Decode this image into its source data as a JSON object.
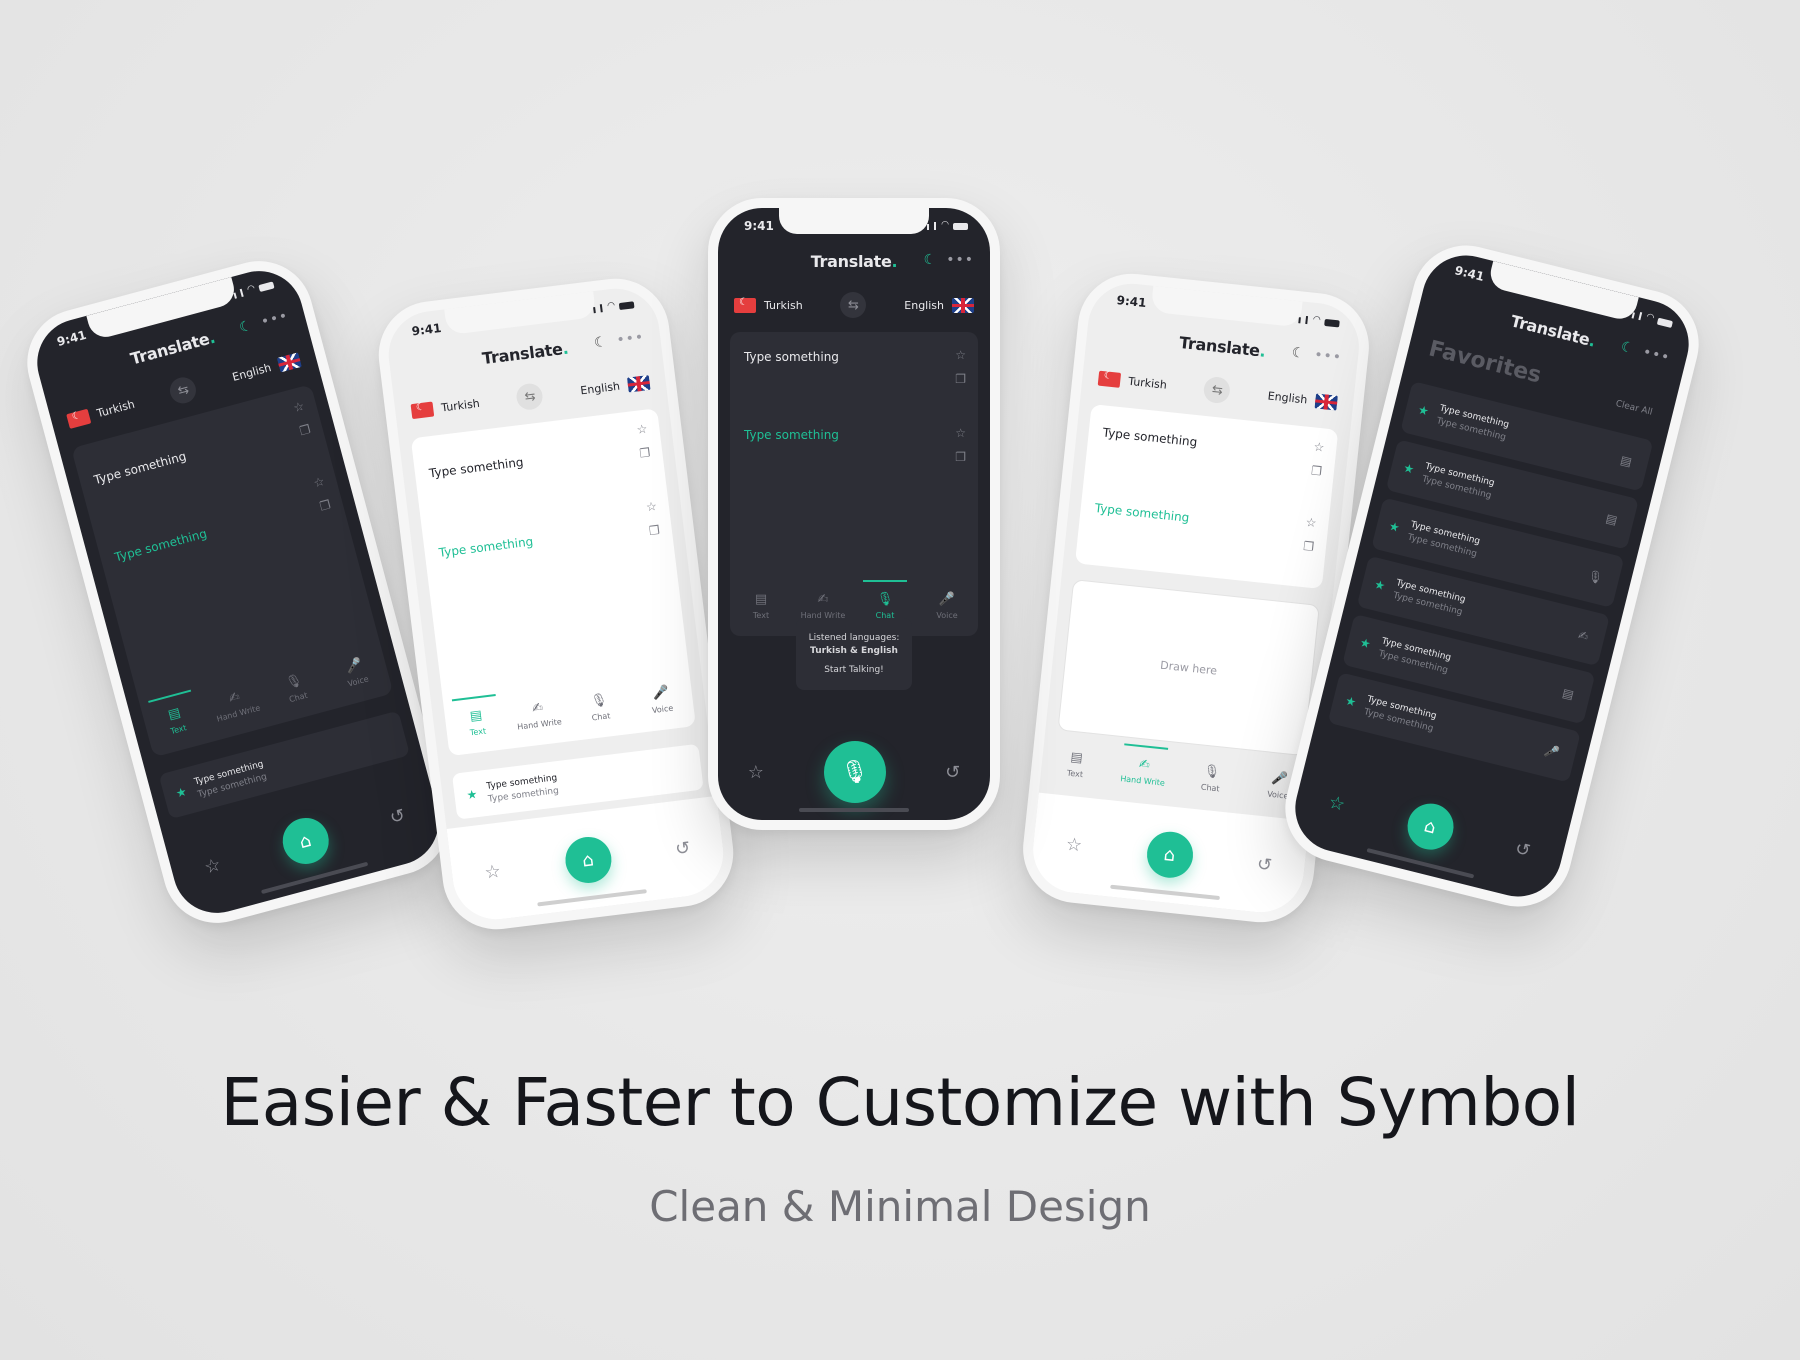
{
  "status_time": "9:41",
  "app": {
    "title": "Translate",
    "title_dot": "."
  },
  "languages": {
    "source": "Turkish",
    "target": "English"
  },
  "fields": {
    "source_text": "Type something",
    "target_text": "Type something"
  },
  "tabs": [
    {
      "label": "Text",
      "icon": "document-icon"
    },
    {
      "label": "Hand Write",
      "icon": "handwriting-icon"
    },
    {
      "label": "Chat",
      "icon": "microphones-icon"
    },
    {
      "label": "Voice",
      "icon": "microphone-icon"
    }
  ],
  "recent": {
    "title": "Type something",
    "subtitle": "Type something"
  },
  "listen": {
    "line1": "Listened languages:",
    "line2": "Turkish & English",
    "line3": "Start Talking!"
  },
  "draw_placeholder": "Draw here",
  "favorites": {
    "title": "Favorites",
    "clear_all": "Clear All",
    "items": [
      {
        "title": "Type something",
        "subtitle": "Type something"
      },
      {
        "title": "Type something",
        "subtitle": "Type something"
      },
      {
        "title": "Type something",
        "subtitle": "Type something"
      },
      {
        "title": "Type something",
        "subtitle": "Type something"
      },
      {
        "title": "Type something",
        "subtitle": "Type something"
      },
      {
        "title": "Type something",
        "subtitle": "Type something"
      }
    ]
  },
  "headline": "Easier & Faster to Customize with Symbol",
  "subheadline": "Clean & Minimal Design",
  "colors": {
    "accent": "#1fbf95",
    "dark_bg": "#23242b",
    "card_dark": "#2d2e36",
    "light_bg": "#eeeeee"
  }
}
